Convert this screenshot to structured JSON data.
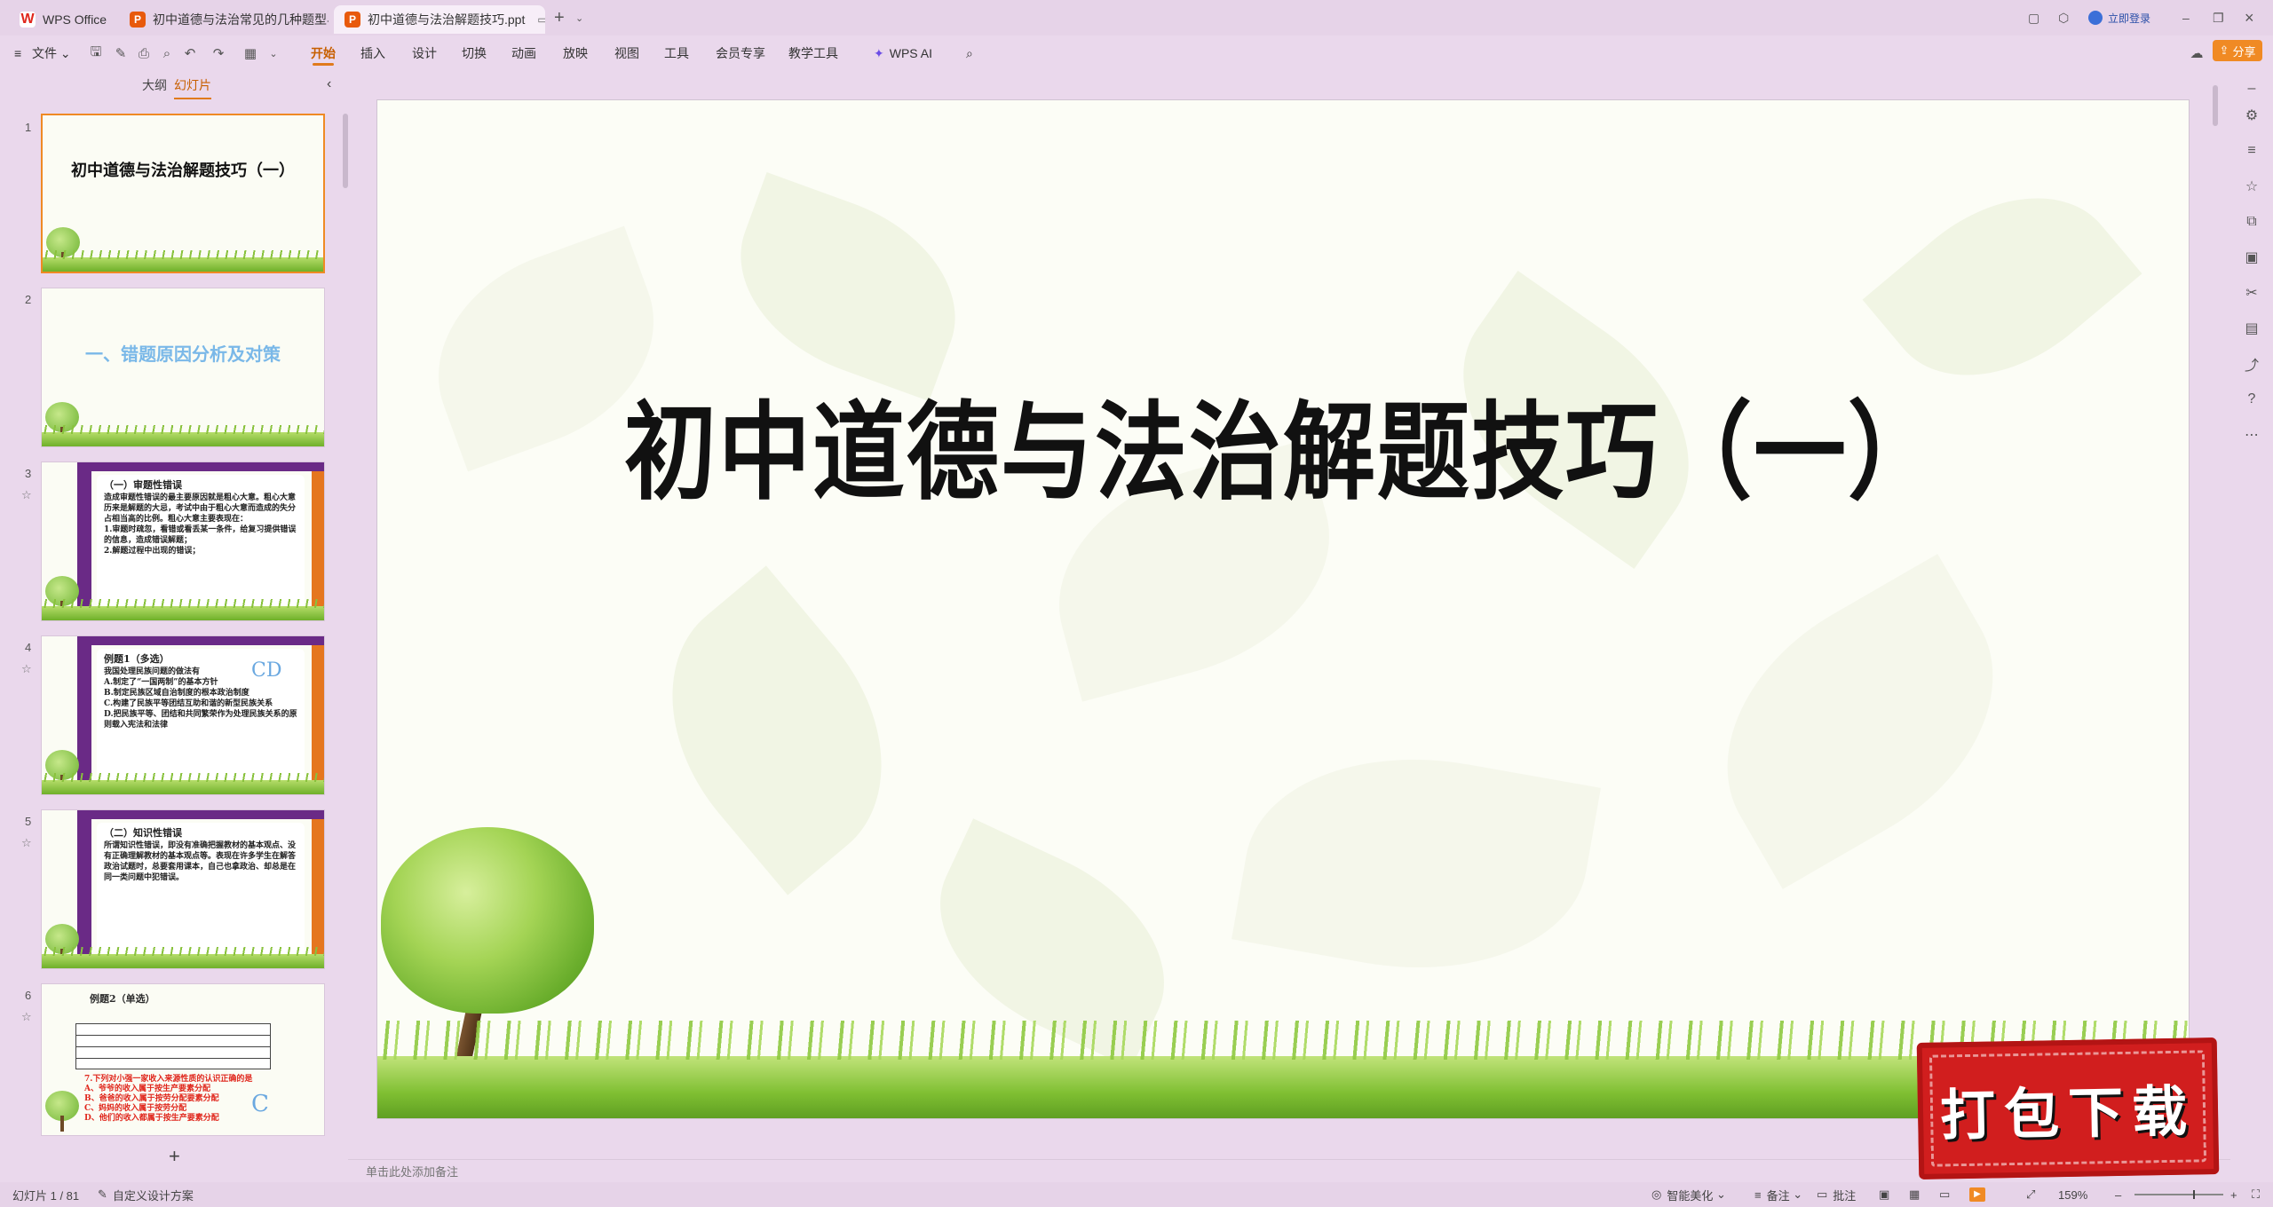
{
  "titlebar": {
    "tabs": [
      {
        "label": "WPS Office",
        "icon": "wps-logo-icon"
      },
      {
        "label": "初中道德与法治常见的几种题型与命",
        "icon": "ppt-file-icon"
      },
      {
        "label": "初中道德与法治解题技巧.ppt",
        "icon": "ppt-file-icon"
      }
    ],
    "new_tab": "+",
    "login": "立即登录"
  },
  "menu": {
    "file": "文件",
    "items": [
      "开始",
      "插入",
      "设计",
      "切换",
      "动画",
      "放映",
      "视图",
      "工具",
      "会员专享",
      "教学工具",
      "WPS AI"
    ],
    "active": "开始",
    "share": "分享"
  },
  "left_panel": {
    "tabs": [
      "大纲",
      "幻灯片"
    ],
    "active_tab": "幻灯片",
    "add": "+",
    "thumbnails": [
      {
        "num": "1",
        "title": "初中道德与法治解题技巧（一）"
      },
      {
        "num": "2",
        "title": "一、错题原因分析及对策"
      },
      {
        "num": "3",
        "heading": "（一）审题性错误",
        "lines": [
          "造成审题性错误的最主要原因就是粗心大意。粗心大意历来是解题的大忌，考试中由于粗心大意而造成的失分占相当高的比例。粗心大意主要表现在：",
          "1.审题时疏忽，看错或看丢某一条件，给复习提供错误的信息，造成错误解题；",
          "2.解题过程中出现的错误；"
        ]
      },
      {
        "num": "4",
        "heading": "例题1（多选）",
        "lines": [
          "我国处理民族问题的做法有",
          "A.制定了“一国两制”的基本方针",
          "B.制定民族区域自治制度的根本政治制度",
          "C.构建了民族平等团结互助和谐的新型民族关系",
          "D.把民族平等、团结和共同繁荣作为处理民族关系的原则载入宪法和法律"
        ],
        "answer": "CD"
      },
      {
        "num": "5",
        "heading": "（二）知识性错误",
        "lines": [
          "所谓知识性错误，即没有准确把握教材的基本观点、没有正确理解教材的基本观点等。表现在许多学生在解答政治试题时，总要套用课本，自己也拿政治、却总是在同一类问题中犯错误。"
        ]
      },
      {
        "num": "6",
        "heading": "例题2（单选）",
        "lines": [
          "7.下列对小强一家收入来源性质的认识正确的是",
          "A、爷爷的收入属于按生产要素分配",
          "B、爸爸的收入属于按劳分配要素分配",
          "C、妈妈的收入属于按劳分配",
          "D、他们的收入都属于按生产要素分配"
        ],
        "answer": "C"
      }
    ]
  },
  "slide": {
    "title": "初中道德与法治解题技巧（一）",
    "notes_placeholder": "单击此处添加备注"
  },
  "statusbar": {
    "slide_info": "幻灯片 1 / 81",
    "design": "自定义设计方案",
    "smart": "智能美化",
    "notes": "备注",
    "comments": "批注",
    "zoom": "159%"
  },
  "stamp": {
    "text": "打包下载"
  },
  "colors": {
    "accent": "#e07a1c",
    "background": "#ead8ec",
    "stamp": "#d11e1e"
  }
}
